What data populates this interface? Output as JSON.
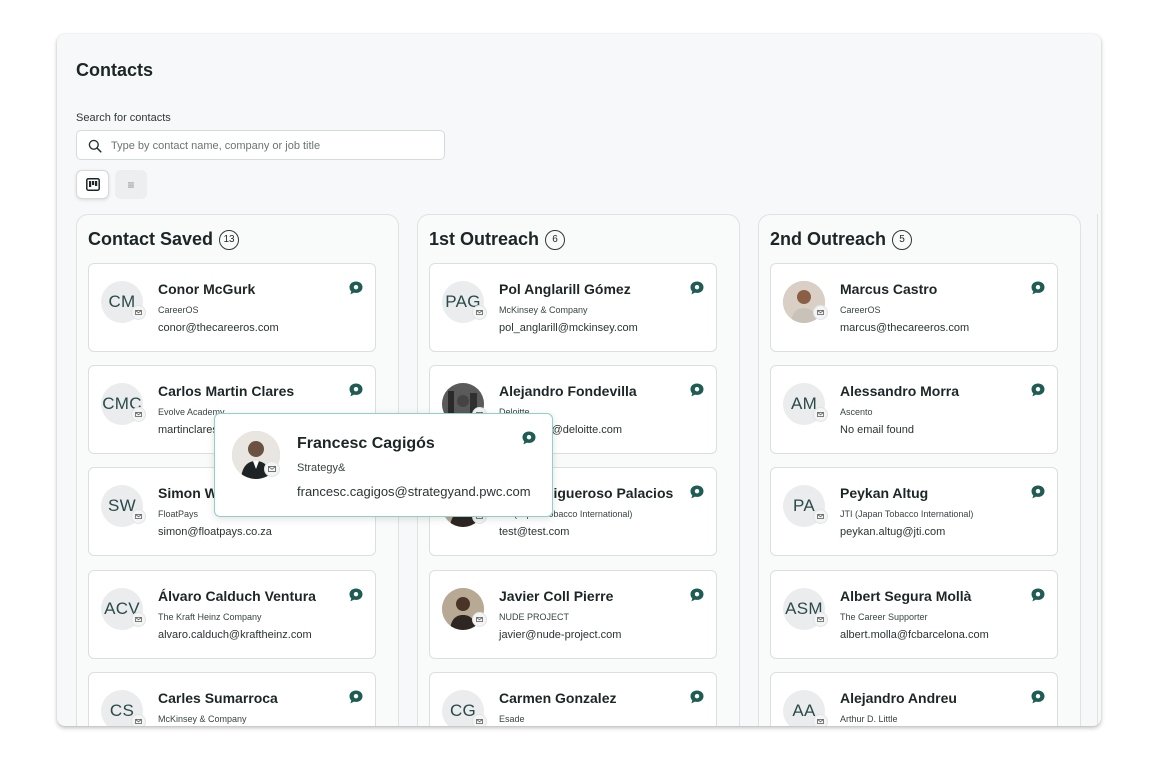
{
  "page": {
    "title": "Contacts"
  },
  "search": {
    "label": "Search for contacts",
    "placeholder": "Type by contact name, company or job title",
    "value": ""
  },
  "view_toggle": {
    "active": "board-view-icon",
    "inactive": "list-view-icon"
  },
  "colors": {
    "accent": "#1f5c54",
    "popup_border": "#8fd0c8"
  },
  "columns": [
    {
      "title": "Contact Saved",
      "count": "13",
      "cards": [
        {
          "initials": "CM",
          "name": "Conor McGurk",
          "company": "CareerOS",
          "email": "conor@thecareeros.com"
        },
        {
          "initials": "CMC",
          "name": "Carlos Martin Clares",
          "company": "Evolve Academy",
          "email": "martinclares@evolveacademy.com"
        },
        {
          "initials": "SW",
          "name": "Simon Williams",
          "company": "FloatPays",
          "email": "simon@floatpays.co.za"
        },
        {
          "initials": "ACV",
          "name": "Álvaro Calduch Ventura",
          "company": "The Kraft Heinz Company",
          "email": "alvaro.calduch@kraftheinz.com"
        },
        {
          "initials": "CS",
          "name": "Carles Sumarroca",
          "company": "McKinsey & Company",
          "email": ""
        }
      ]
    },
    {
      "title": "1st Outreach",
      "count": "6",
      "cards": [
        {
          "initials": "PAG",
          "name": "Pol Anglarill Gómez",
          "company": "McKinsey & Company",
          "email": "pol_anglarill@mckinsey.com"
        },
        {
          "initials": "",
          "photo": "p2",
          "name": "Alejandro Fondevilla",
          "company": "Deloitte",
          "email": "afondevilla@deloitte.com"
        },
        {
          "initials": "",
          "photo": "p3",
          "name": "Daniel Figueroso Palacios",
          "company": "JTI (Japan Tobacco International)",
          "email": "test@test.com"
        },
        {
          "initials": "",
          "photo": "p3",
          "name": "Javier Coll Pierre",
          "company": "NUDE PROJECT",
          "email": "javier@nude-project.com"
        },
        {
          "initials": "CG",
          "name": "Carmen Gonzalez",
          "company": "Esade",
          "email": ""
        }
      ]
    },
    {
      "title": "2nd Outreach",
      "count": "5",
      "cards": [
        {
          "initials": "",
          "photo": "p1",
          "name": "Marcus Castro",
          "company": "CareerOS",
          "email": "marcus@thecareeros.com"
        },
        {
          "initials": "AM",
          "name": "Alessandro Morra",
          "company": "Ascento",
          "email": "No email found"
        },
        {
          "initials": "PA",
          "name": "Peykan Altug",
          "company": "JTI (Japan Tobacco International)",
          "email": "peykan.altug@jti.com"
        },
        {
          "initials": "ASM",
          "name": "Albert Segura Mollà",
          "company": "The Career Supporter",
          "email": "albert.molla@fcbarcelona.com"
        },
        {
          "initials": "AA",
          "name": "Alejandro Andreu",
          "company": "Arthur D. Little",
          "email": ""
        }
      ]
    }
  ],
  "popup": {
    "name": "Francesc Cagigós",
    "company": "Strategy&",
    "email": "francesc.cagigos@strategyand.pwc.com"
  }
}
